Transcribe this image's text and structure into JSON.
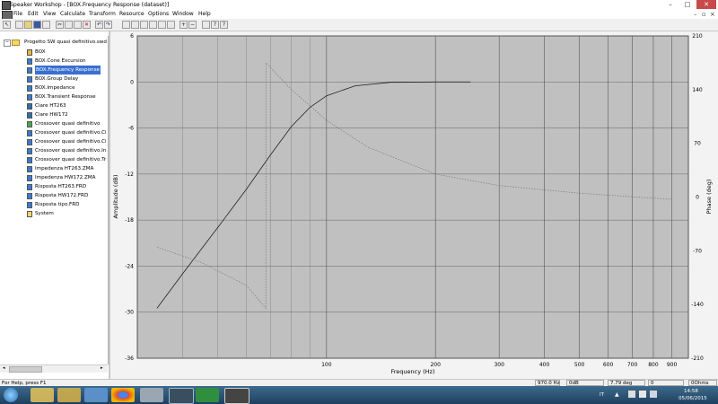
{
  "window": {
    "title": "Speaker Workshop - [BOX.Frequency Response (dataset)]",
    "controls": [
      "–",
      "□",
      "✕"
    ]
  },
  "menu": [
    "File",
    "Edit",
    "View",
    "Calculate",
    "Transform",
    "Resource",
    "Options",
    "Window",
    "Help"
  ],
  "mdi_controls": [
    "–",
    "▫",
    "×"
  ],
  "tree": {
    "root": "Progetto SW quasi definitivo.swd",
    "items": [
      {
        "label": "BOX",
        "icon": "speaker-icon"
      },
      {
        "label": "BOX.Cone Excursion",
        "icon": "dataset-icon"
      },
      {
        "label": "BOX.Frequency Response",
        "icon": "dataset-icon",
        "selected": true
      },
      {
        "label": "BOX.Group Delay",
        "icon": "dataset-icon"
      },
      {
        "label": "BOX.Impedance",
        "icon": "dataset-icon"
      },
      {
        "label": "BOX.Transient Response",
        "icon": "dataset-icon"
      },
      {
        "label": "Ciare HT263",
        "icon": "driver-icon"
      },
      {
        "label": "Ciare HW172",
        "icon": "driver-icon"
      },
      {
        "label": "Crossover quasi definitivo",
        "icon": "network-icon"
      },
      {
        "label": "Crossover quasi definitivo.Ci",
        "icon": "dataset-icon"
      },
      {
        "label": "Crossover quasi definitivo.Ci",
        "icon": "dataset-icon"
      },
      {
        "label": "Crossover quasi definitivo.In",
        "icon": "dataset-icon"
      },
      {
        "label": "Crossover quasi definitivo.Tr",
        "icon": "dataset-icon"
      },
      {
        "label": "Impedenza HT263.ZMA",
        "icon": "dataset-icon"
      },
      {
        "label": "Impedenza HW172.ZMA",
        "icon": "dataset-icon"
      },
      {
        "label": "Risposta HT263.FRD",
        "icon": "dataset-icon"
      },
      {
        "label": "Risposta HW172.FRD",
        "icon": "dataset-icon"
      },
      {
        "label": "Risposta tipo.FRD",
        "icon": "dataset-icon"
      },
      {
        "label": "System",
        "icon": "folder-icon"
      }
    ]
  },
  "status": {
    "help": "For Help, press F1",
    "freq": "970.0 Hz",
    "amp": "0dB",
    "phase": "7.79 deg",
    "zero": "0",
    "ohms": "0Ohms"
  },
  "taskbar": {
    "lang": "IT",
    "time": "14:58",
    "date": "05/06/2015"
  },
  "chart_data": {
    "type": "line",
    "xlabel": "Frequency (Hz)",
    "ylabel": "Amplitude (dB)",
    "y2label": "Phase (deg)",
    "x_scale": "log",
    "x_ticks": [
      100,
      200,
      300,
      400,
      500,
      600,
      700,
      800,
      900
    ],
    "ylim": [
      -36,
      6
    ],
    "y_ticks": [
      6,
      0,
      -6,
      -12,
      -18,
      -24,
      -30,
      -36
    ],
    "y2lim": [
      -210,
      210
    ],
    "y2_ticks": [
      210,
      140,
      70,
      0,
      -70,
      -140,
      -210
    ],
    "grid": true,
    "series": [
      {
        "role": "amplitude",
        "axis": "left",
        "style": "solid",
        "points": [
          [
            34,
            -29.5
          ],
          [
            40,
            -25
          ],
          [
            50,
            -19
          ],
          [
            60,
            -14
          ],
          [
            70,
            -9.5
          ],
          [
            80,
            -5.8
          ],
          [
            90,
            -3.3
          ],
          [
            100,
            -1.8
          ],
          [
            120,
            -0.5
          ],
          [
            150,
            -0.05
          ],
          [
            200,
            0
          ],
          [
            250,
            0
          ]
        ]
      },
      {
        "role": "phase",
        "axis": "right",
        "style": "dotted",
        "points": [
          [
            34,
            -65
          ],
          [
            45,
            -85
          ],
          [
            60,
            -115
          ],
          [
            68,
            -145
          ],
          [
            68,
            175
          ],
          [
            80,
            140
          ],
          [
            100,
            100
          ],
          [
            130,
            65
          ],
          [
            200,
            30
          ],
          [
            300,
            15
          ],
          [
            500,
            5
          ],
          [
            900,
            -3
          ]
        ]
      }
    ]
  }
}
